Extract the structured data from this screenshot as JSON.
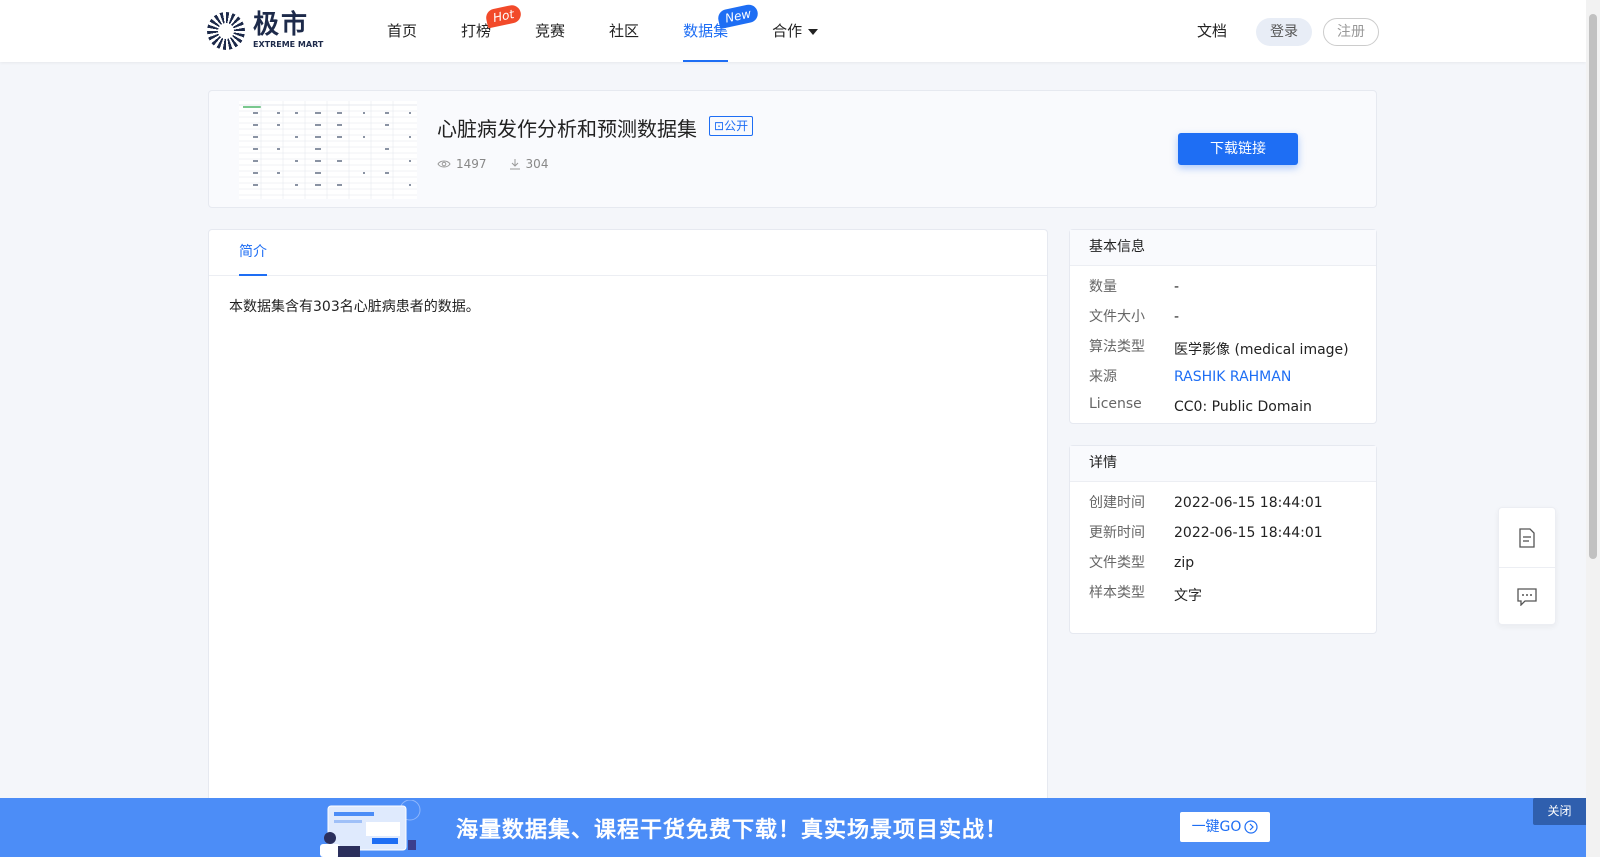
{
  "brand": {
    "name_cn": "极市",
    "name_en": "EXTREME MART"
  },
  "nav": {
    "items": [
      {
        "label": "首页",
        "badge": ""
      },
      {
        "label": "打榜",
        "badge": "Hot"
      },
      {
        "label": "竞赛",
        "badge": ""
      },
      {
        "label": "社区",
        "badge": ""
      },
      {
        "label": "数据集",
        "badge": "New"
      },
      {
        "label": "合作",
        "badge": ""
      }
    ],
    "active": "数据集",
    "doc": "文档",
    "login": "登录",
    "register": "注册"
  },
  "dataset": {
    "title": "心脏病发作分析和预测数据集",
    "visibility": "公开",
    "views": "1497",
    "downloads": "304",
    "download_button": "下载链接"
  },
  "tabs": {
    "intro": "简介"
  },
  "intro_text": "本数据集含有303名心脏病患者的数据。",
  "basic_info": {
    "title": "基本信息",
    "rows": [
      {
        "key": "数量",
        "value": "-"
      },
      {
        "key": "文件大小",
        "value": "-"
      },
      {
        "key": "算法类型",
        "value": "医学影像 (medical image)"
      },
      {
        "key": "来源",
        "value": "RASHIK RAHMAN"
      },
      {
        "key": "License",
        "value": "CC0: Public Domain"
      }
    ]
  },
  "details": {
    "title": "详情",
    "rows": [
      {
        "key": "创建时间",
        "value": "2022-06-15 18:44:01"
      },
      {
        "key": "更新时间",
        "value": "2022-06-15 18:44:01"
      },
      {
        "key": "文件类型",
        "value": "zip"
      },
      {
        "key": "样本类型",
        "value": "文字"
      }
    ]
  },
  "banner": {
    "text": "海量数据集、课程干货免费下载！真实场景项目实战！",
    "go_button": "一键GO",
    "close": "关闭"
  },
  "colors": {
    "accent": "#1e6ef4",
    "hot": "#f24a2a",
    "banner": "#4c8df7"
  }
}
